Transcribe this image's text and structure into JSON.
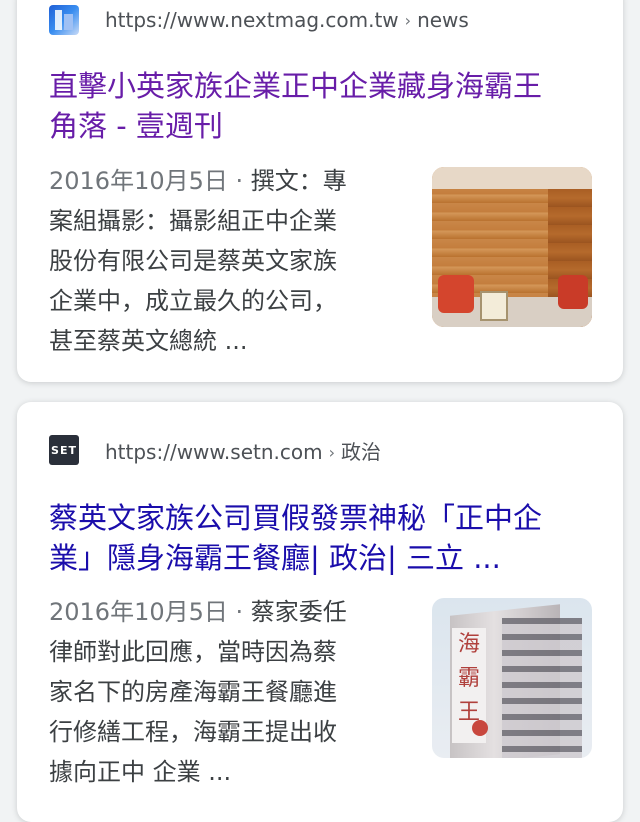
{
  "results": [
    {
      "source_url": "https://www.nextmag.com.tw",
      "breadcrumb": "news",
      "favicon_icon": "nextmag-favicon",
      "title_line1": "直擊小英家族企業正中企業藏身海霸王",
      "title_line2": "角落 - 壹週刊",
      "title_color": "#681da8",
      "date": "2016年10月5日",
      "snippet_lines": [
        "撰文：專",
        "案組攝影：攝影組正中企業",
        "股份有限公司是蔡英文家族",
        "企業中，成立最久的公司，",
        "甚至蔡英文總統 ..."
      ],
      "thumbnail_icon": "wood-paneled-room-thumbnail"
    },
    {
      "source_url": "https://www.setn.com",
      "breadcrumb": "政治",
      "favicon_text": "SET",
      "title_line1": "蔡英文家族公司買假發票神秘「正中企",
      "title_line2": "業」隱身海霸王餐廳| 政治| 三立 ...",
      "title_color": "#1a0dab",
      "date": "2016年10月5日",
      "snippet_lines": [
        "蔡家委任",
        "律師對此回應，當時因為蔡",
        "家名下的房產海霸王餐廳進",
        "行修繕工程，海霸王提出收",
        "據向正中 企業 ..."
      ],
      "thumbnail_sign_text": "海霸王",
      "thumbnail_icon": "building-thumbnail"
    }
  ]
}
